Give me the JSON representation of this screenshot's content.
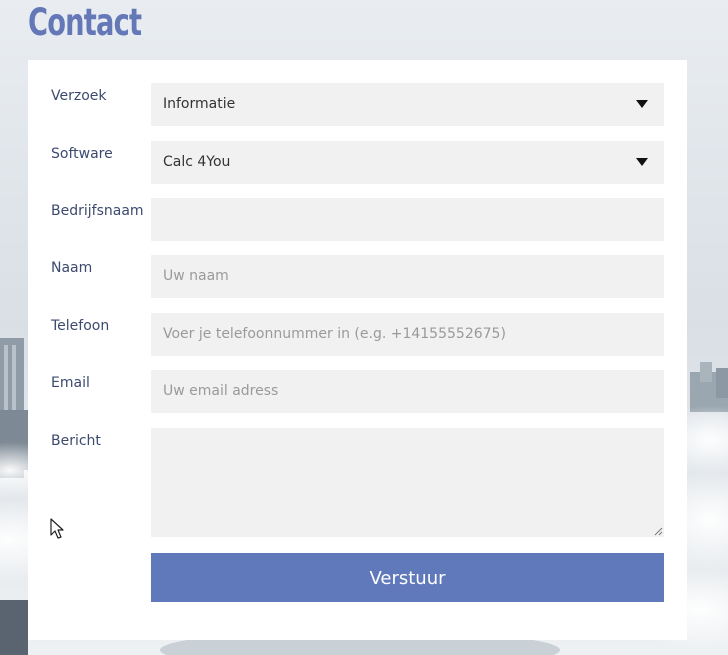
{
  "page": {
    "title": "Contact"
  },
  "form": {
    "fields": [
      {
        "label": "Verzoek",
        "type": "select",
        "value": "Informatie",
        "placeholder": ""
      },
      {
        "label": "Software",
        "type": "select",
        "value": "Calc 4You",
        "placeholder": ""
      },
      {
        "label": "Bedrijfsnaam",
        "type": "text",
        "value": "",
        "placeholder": ""
      },
      {
        "label": "Naam",
        "type": "text",
        "value": "",
        "placeholder": "Uw naam"
      },
      {
        "label": "Telefoon",
        "type": "tel",
        "value": "",
        "placeholder": "Voer je telefoonnummer in (e.g. +14155552675)"
      },
      {
        "label": "Email",
        "type": "email",
        "value": "",
        "placeholder": "Uw email adress"
      },
      {
        "label": "Bericht",
        "type": "textarea",
        "value": "",
        "placeholder": ""
      }
    ],
    "submit_label": "Verstuur"
  },
  "colors": {
    "accent": "#6079bb",
    "title": "#6478b8",
    "label": "#3c4a6e",
    "field_bg": "#f1f1f1"
  },
  "icons": {
    "select_arrow": "caret-down-icon",
    "resize_grip": "resize-handle-icon",
    "cursor": "mouse-pointer-icon"
  }
}
